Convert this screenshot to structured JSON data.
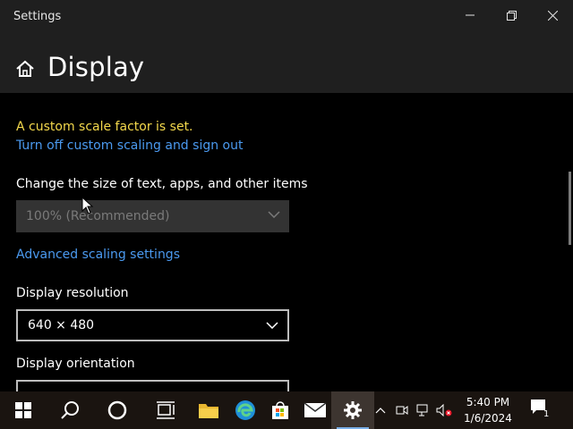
{
  "window": {
    "title": "Settings"
  },
  "header": {
    "title": "Display"
  },
  "scale": {
    "warning": "A custom scale factor is set.",
    "turn_off_link": "Turn off custom scaling and sign out",
    "size_label": "Change the size of text, apps, and other items",
    "size_value": "100% (Recommended)",
    "advanced_link": "Advanced scaling settings"
  },
  "resolution": {
    "label": "Display resolution",
    "value": "640 × 480"
  },
  "orientation": {
    "label": "Display orientation"
  },
  "taskbar": {
    "time": "5:40 PM",
    "date": "1/6/2024",
    "notification_count": "1"
  },
  "colors": {
    "warning": "#f3d84c",
    "link": "#4b9af0",
    "accent": "#7ab0e8"
  }
}
